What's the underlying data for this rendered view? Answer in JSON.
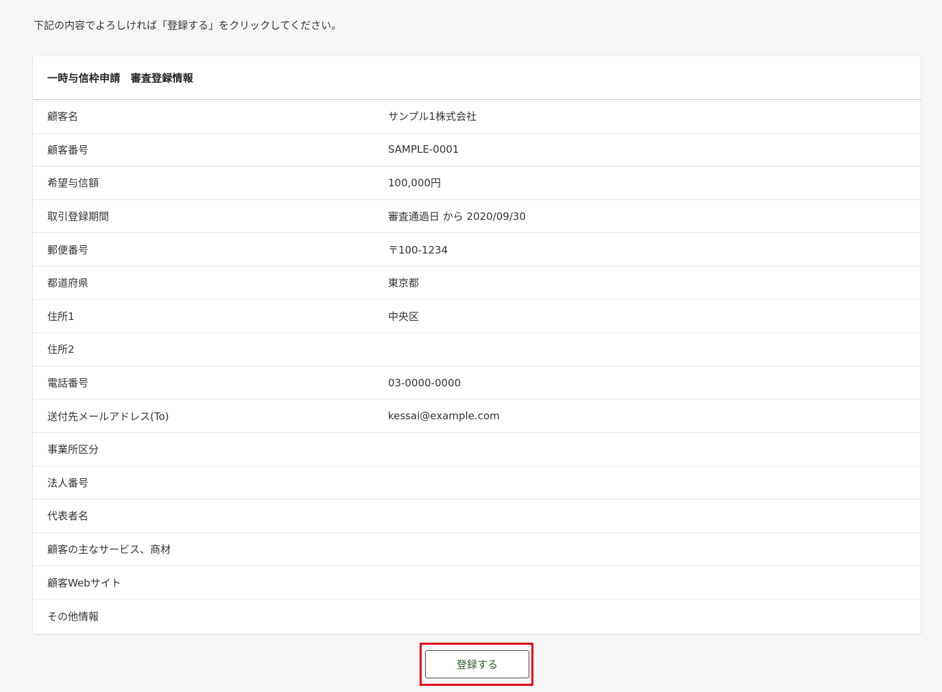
{
  "instruction": "下記の内容でよろしければ「登録する」をクリックしてください。",
  "card": {
    "title": "一時与信枠申請　審査登録情報",
    "rows": [
      {
        "label": "顧客名",
        "value": "サンプル1株式会社"
      },
      {
        "label": "顧客番号",
        "value": "SAMPLE-0001"
      },
      {
        "label": "希望与信額",
        "value": "100,000円"
      },
      {
        "label": "取引登録期間",
        "value": "審査通過日 から 2020/09/30"
      },
      {
        "label": "郵便番号",
        "value": "〒100-1234"
      },
      {
        "label": "都道府県",
        "value": "東京都"
      },
      {
        "label": "住所1",
        "value": "中央区"
      },
      {
        "label": "住所2",
        "value": ""
      },
      {
        "label": "電話番号",
        "value": "03-0000-0000"
      },
      {
        "label": "送付先メールアドレス(To)",
        "value": "kessai@example.com"
      },
      {
        "label": "事業所区分",
        "value": ""
      },
      {
        "label": "法人番号",
        "value": ""
      },
      {
        "label": "代表者名",
        "value": ""
      },
      {
        "label": "顧客の主なサービス、商材",
        "value": ""
      },
      {
        "label": "顧客Webサイト",
        "value": ""
      },
      {
        "label": "その他情報",
        "value": ""
      }
    ]
  },
  "actions": {
    "submit_label": "登録する",
    "highlight_color": "#e60012"
  }
}
